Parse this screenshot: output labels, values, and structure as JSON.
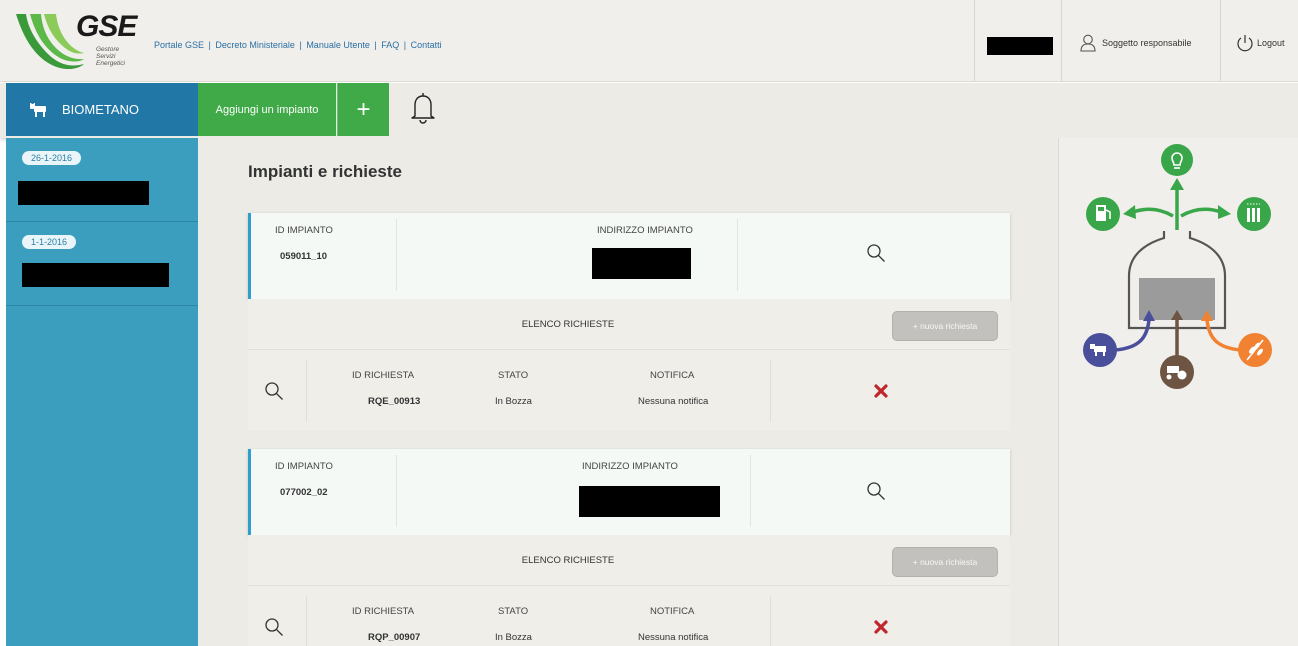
{
  "header": {
    "logo": {
      "name": "GSE",
      "sub_lines": [
        "Gestore",
        "Servizi",
        "Energetici"
      ]
    },
    "links": [
      "Portale GSE",
      "Decreto Ministeriale",
      "Manuale Utente",
      "FAQ",
      "Contatti"
    ],
    "link_separator": "|",
    "user_label": "Soggetto responsabile",
    "logout_label": "Logout"
  },
  "navbar": {
    "section_label": "BIOMETANO",
    "add_label": "Aggiungi un impianto",
    "plus_label": "+"
  },
  "sidebar": {
    "items": [
      {
        "date": "26-1-2016"
      },
      {
        "date": "1-1-2016"
      }
    ]
  },
  "main": {
    "title": "Impianti e richieste",
    "impianti": [
      {
        "id_label": "ID IMPIANTO",
        "id_value": "059011_10",
        "address_label": "INDIRIZZO IMPIANTO",
        "elenco_label": "ELENCO RICHIESTE",
        "new_request_label": "+ nuova richiesta",
        "richiesta": {
          "id_label": "ID RICHIESTA",
          "id_value": "RQE_00913",
          "stato_label": "STATO",
          "stato_value": "In Bozza",
          "notifica_label": "NOTIFICA",
          "notifica_value": "Nessuna notifica"
        }
      },
      {
        "id_label": "ID IMPIANTO",
        "id_value": "077002_02",
        "address_label": "INDIRIZZO IMPIANTO",
        "elenco_label": "ELENCO RICHIESTE",
        "new_request_label": "+ nuova richiesta",
        "richiesta": {
          "id_label": "ID RICHIESTA",
          "id_value": "RQP_00907",
          "stato_label": "STATO",
          "stato_value": "In Bozza",
          "notifica_label": "NOTIFICA",
          "notifica_value": "Nessuna notifica"
        }
      }
    ]
  },
  "icons": {
    "cow": "cow-icon",
    "bell": "bell-icon",
    "user": "user-icon",
    "power": "power-icon",
    "search": "search-icon",
    "delete": "delete-x-icon"
  },
  "colors": {
    "brand_blue": "#2178a6",
    "sidebar_blue": "#3b9ebf",
    "action_green": "#40aa48",
    "infographic_green": "#3aa64a",
    "infographic_purple": "#4a4f9c",
    "infographic_brown": "#6e5442",
    "infographic_orange": "#f08232",
    "delete_red": "#c0272d"
  }
}
